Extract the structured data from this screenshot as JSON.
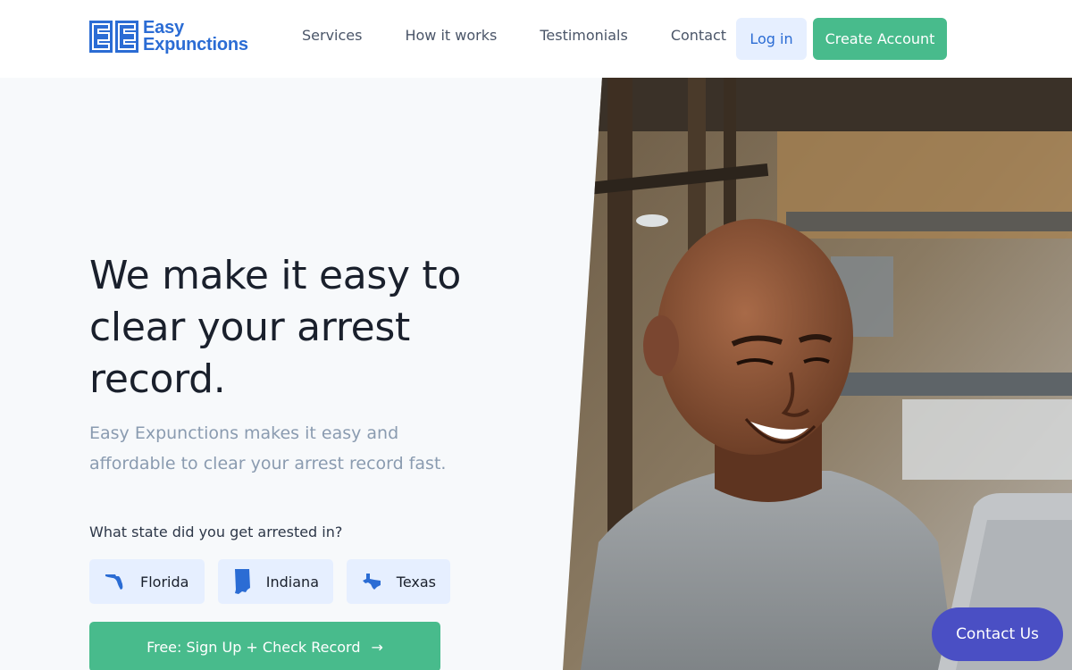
{
  "brand": {
    "line1": "Easy",
    "line2": "Expunctions",
    "color": "#2b6cd4"
  },
  "nav": {
    "links": [
      "Services",
      "How it works",
      "Testimonials",
      "Contact"
    ],
    "login_label": "Log in",
    "create_label": "Create Account"
  },
  "hero": {
    "title": "We make it easy to clear your arrest record.",
    "subtitle": "Easy Expunctions makes it easy and affordable to clear your arrest record fast.",
    "state_question": "What state did you get arrested in?",
    "states": [
      "Florida",
      "Indiana",
      "Texas"
    ],
    "cta_label": "Free: Sign Up + Check Record"
  },
  "contact_us_label": "Contact Us",
  "colors": {
    "accent_green": "#48bb8c",
    "accent_blue": "#2b6cd4",
    "chat_purple": "#4a4fc4"
  }
}
